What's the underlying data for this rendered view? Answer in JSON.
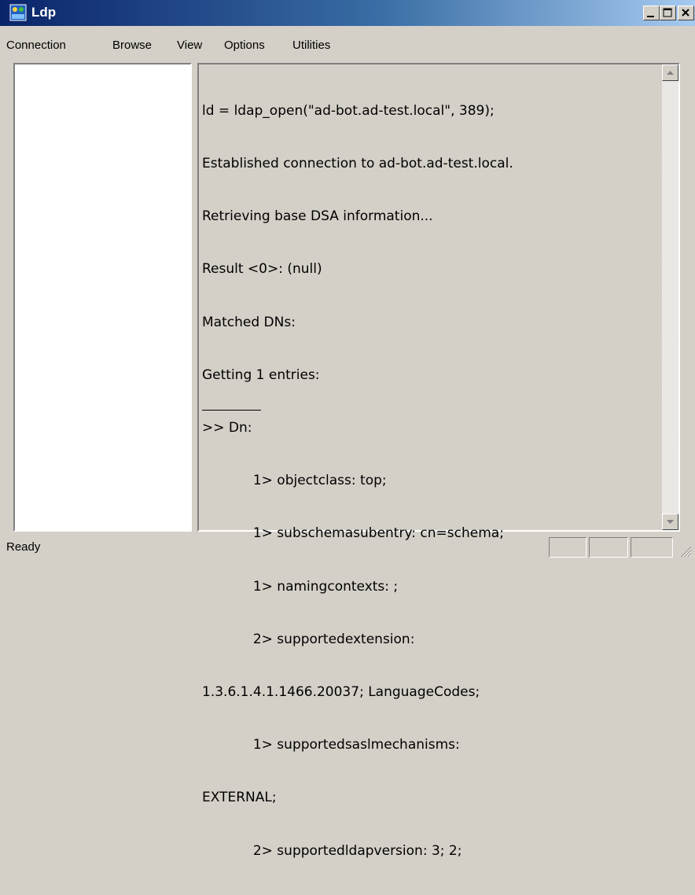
{
  "window": {
    "title": "Ldp",
    "icon": "ldap-app-icon",
    "controls": [
      "minimize-icon",
      "maximize-icon",
      "close-icon"
    ]
  },
  "menu": {
    "items": [
      "Connection",
      "Browse",
      "View",
      "Options",
      "Utilities"
    ]
  },
  "output": {
    "lines": [
      "ld = ldap_open(\"ad-bot.ad-test.local\", 389);",
      "Established connection to ad-bot.ad-test.local.",
      "Retrieving base DSA information...",
      "Result <0>: (null)",
      "Matched DNs:",
      "Getting 1 entries:",
      ">> Dn:",
      "            1> objectclass: top;",
      "            1> subschemasubentry: cn=schema;",
      "            1> namingcontexts: ;",
      "            2> supportedextension:",
      "1.3.6.1.4.1.1466.20037; LanguageCodes;",
      "            1> supportedsaslmechanisms:",
      "EXTERNAL;",
      "            2> supportedldapversion: 3; 2;"
    ]
  },
  "status": {
    "text": "Ready"
  },
  "colors": {
    "titlebar_start": "#0a246a",
    "titlebar_end": "#a6caf0",
    "face": "#d4d0c8"
  }
}
